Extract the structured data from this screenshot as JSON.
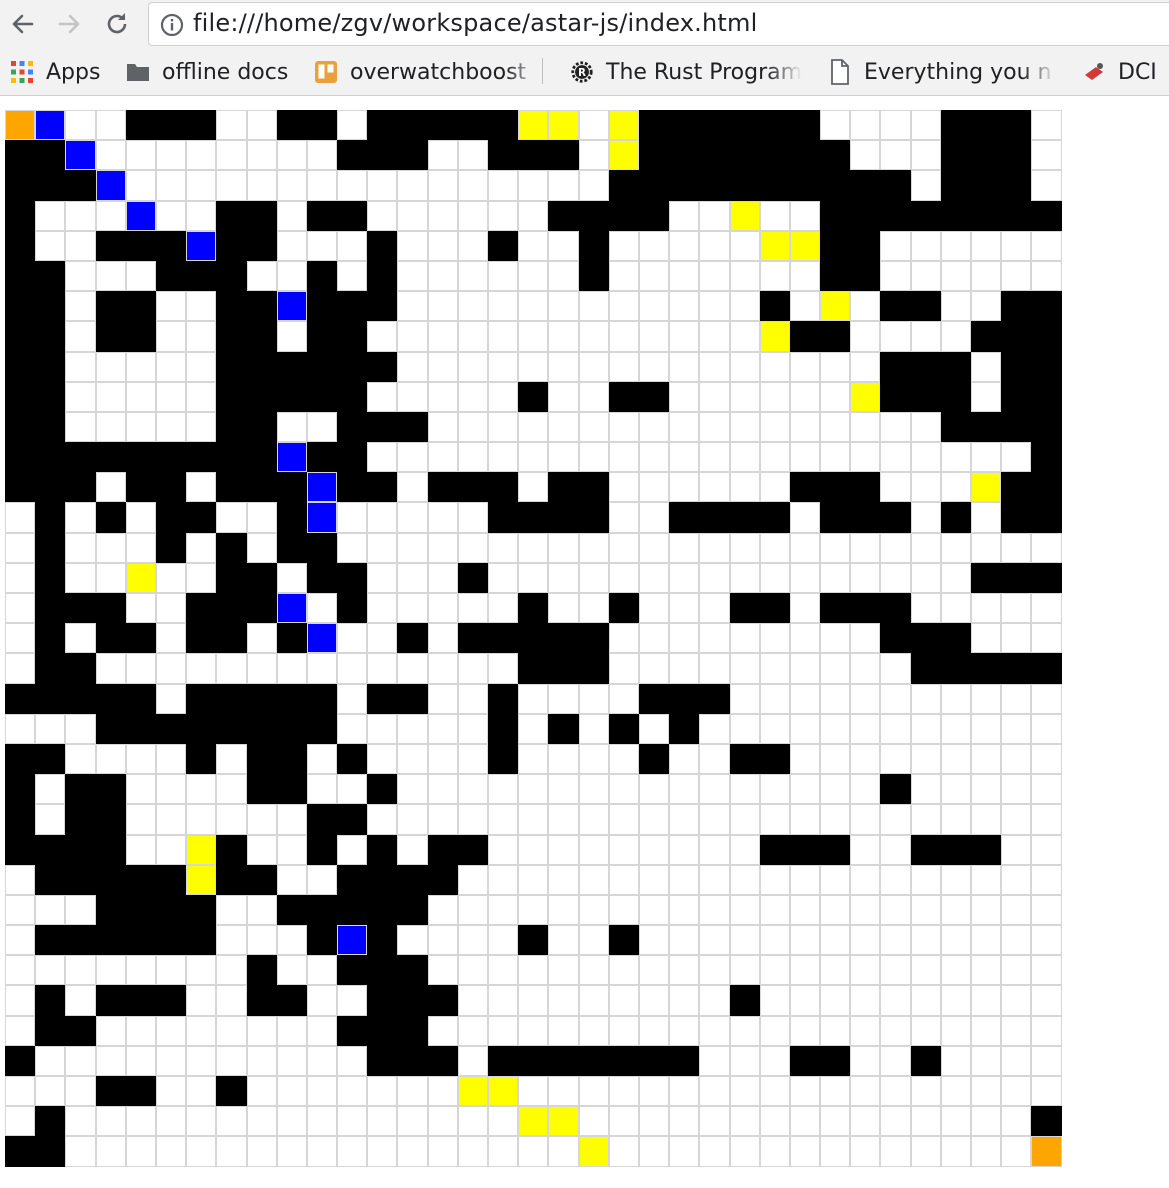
{
  "browser": {
    "url": "file:///home/zgv/workspace/astar-js/index.html",
    "bookmarks": [
      {
        "label": "Apps",
        "icon": "apps-grid-icon"
      },
      {
        "label": "offline docs",
        "icon": "folder-icon"
      },
      {
        "label": "overwatchboost",
        "icon": "trello-icon"
      },
      {
        "label": "The Rust Program",
        "icon": "rust-logo-icon"
      },
      {
        "label": "Everything you n",
        "icon": "page-icon"
      },
      {
        "label": "DCI",
        "icon": "dci-icon"
      }
    ]
  },
  "grid": {
    "columns": 35,
    "rows": 35,
    "colors": {
      "wall": "#000000",
      "open": "#ffffff",
      "explored": "#ffff00",
      "path": "#0000ff",
      "endpoint": "#ffa500"
    },
    "cells": [
      "43110001100100000221200000011110001",
      "00311111111000110001200000001110001",
      "00031111111111111111000000000010001",
      "01113110010011111100001121100000000",
      "01100030011101110110111112200111111",
      "00111000110101111110111111100111111",
      "00100110030001111111111110121001100",
      "00100110010011111111111112001111000",
      "00111110000001111111111111111000100",
      "00111110000011111011001111112000100",
      "00111110011000111111111111111110000",
      "00000000030011111111111111111111110",
      "00010010003001000100111111000111200",
      "10101001103111110000110000100010100",
      "10111010100111111111111111111111111",
      "10112110010011101111111111111111000",
      "10001100031011111011011100100011111",
      "10100100103110100000111111111000111",
      "10011111111111111000111111111100000",
      "00000100000100110111100011111111111",
      "11100000000111110101010111111111111",
      "00111101001011110111101100111111111",
      "01001111001101111111111111111011111",
      "01001111110011111111111111111111111",
      "00001120110101001111111110001100011",
      "10000020011000011111111111111111111",
      "11100001100000111111111111111111111",
      "10000001110301111011011111111111111",
      "11111111011000111111111111111111111",
      "10100011001100011111111101111111111",
      "10011111111000111111111111111111111",
      "01111111111100010000000111001101111",
      "11100110111111122111111111111111111",
      "10111111111111111221111111111111110",
      "00111111111111111112111111111111114"
    ]
  }
}
